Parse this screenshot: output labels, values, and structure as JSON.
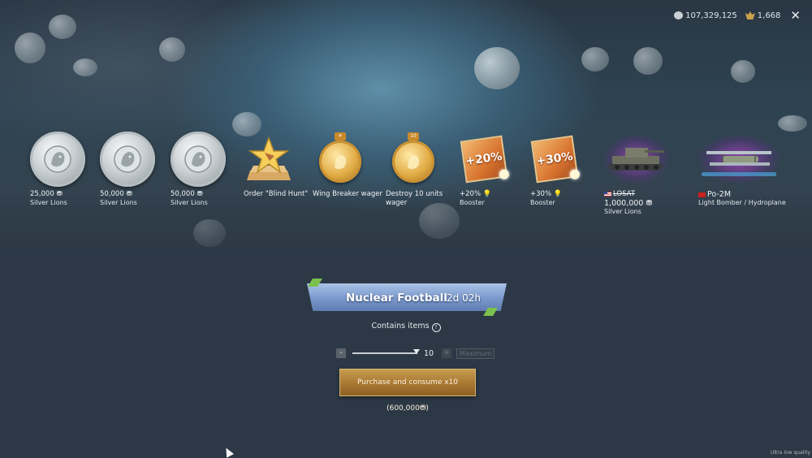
{
  "header": {
    "silver_lions": "107,329,125",
    "golden_eagles": "1,668",
    "close_icon": "close-icon"
  },
  "rewards": [
    {
      "line1": "25,000",
      "line2": "Silver Lions",
      "icon": "silver-lion-medal-icon"
    },
    {
      "line1": "50,000",
      "line2": "Silver Lions",
      "icon": "silver-lion-medal-icon"
    },
    {
      "line1": "50,000",
      "line2": "Silver Lions",
      "icon": "silver-lion-medal-icon"
    },
    {
      "line1": "Order \"Blind Hunt\"",
      "line2": "",
      "icon": "star-trophy-icon"
    },
    {
      "line1": "Wing Breaker wager",
      "line2": "",
      "icon": "gold-wager-medal-icon"
    },
    {
      "line1": "Destroy 10 units",
      "line2": "wager",
      "icon": "gold-wager-medal-icon",
      "tab": "10"
    },
    {
      "line1": "+20%",
      "line2": "Booster",
      "icon": "booster-icon",
      "badge": "+20%"
    },
    {
      "line1": "+30%",
      "line2": "Booster",
      "icon": "booster-icon",
      "badge": "+30%"
    },
    {
      "line0": "LOSAT",
      "line1": "1,000,000",
      "line2": "Silver Lions",
      "icon": "tank-vehicle-icon"
    },
    {
      "line1": "Po-2M",
      "line2": "Light Bomber / Hydroplane",
      "icon": "biplane-vehicle-icon"
    }
  ],
  "banner": {
    "title": "Nuclear Football",
    "timer": "2d 02h"
  },
  "contains_label": "Contains items",
  "quantity": {
    "minus": "-",
    "plus": "+",
    "value": "10",
    "max_label": "Maximum",
    "slider_fraction": 1.0
  },
  "purchase_label": "Purchase and consume x10 (600,000",
  "quality_label": "Ultra low quality",
  "colors": {
    "banner": "#7a98cb",
    "purchase": "#a87832",
    "background": "#2c3845"
  }
}
